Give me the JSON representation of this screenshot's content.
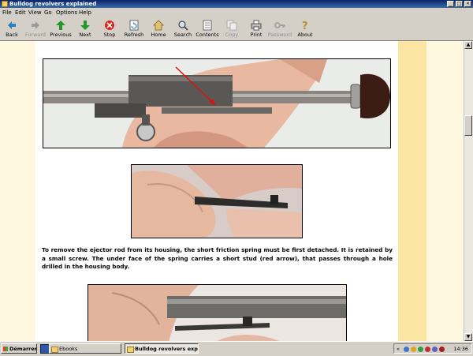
{
  "window": {
    "title": "Bulldog revolvers explained"
  },
  "menu": [
    "File",
    "Edit",
    "View",
    "Go",
    "Options",
    "Help"
  ],
  "toolbar": {
    "back": "Back",
    "forward": "Forward",
    "previous": "Previous",
    "next": "Next",
    "stop": "Stop",
    "refresh": "Refresh",
    "home": "Home",
    "search": "Search",
    "contents": "Contents",
    "copy": "Copy",
    "print": "Print",
    "password": "Password",
    "about": "About"
  },
  "content": {
    "paragraph": "To remove the ejector rod from its housing, the short friction spring must be first detached. It is retained by a small screw. The under face of the spring carries a short stud (red arrow), that passes through a hole drilled in the housing body."
  },
  "taskbar": {
    "start": "Démarrer",
    "items": [
      "Ebooks",
      "Bulldog revolvers exp..."
    ],
    "clock": "14:36",
    "tray_arrow": "«"
  }
}
